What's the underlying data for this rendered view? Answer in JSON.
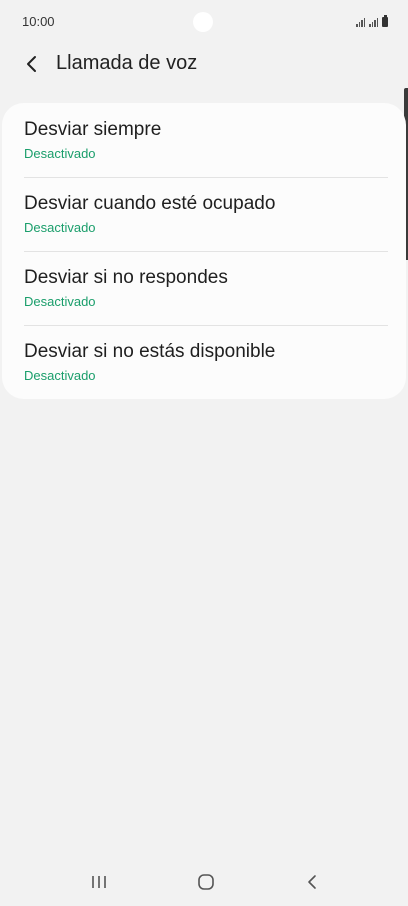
{
  "status_bar": {
    "time": "10:00"
  },
  "header": {
    "back_icon": "chevron-left-icon",
    "title": "Llamada de voz"
  },
  "forwarding_options": [
    {
      "title": "Desviar siempre",
      "status": "Desactivado"
    },
    {
      "title": "Desviar cuando esté ocupado",
      "status": "Desactivado"
    },
    {
      "title": "Desviar si no respondes",
      "status": "Desactivado"
    },
    {
      "title": "Desviar si no estás disponible",
      "status": "Desactivado"
    }
  ],
  "nav_bar": {
    "recents_icon": "recents-icon",
    "home_icon": "home-icon",
    "back_icon": "back-icon"
  },
  "colors": {
    "background": "#f2f2f2",
    "card": "#fcfcfc",
    "status_text": "#1a9e6b"
  }
}
